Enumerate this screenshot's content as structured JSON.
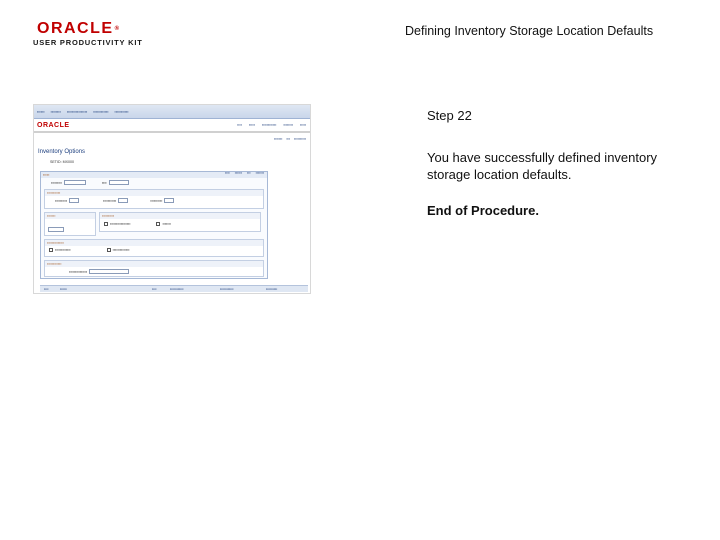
{
  "header": {
    "logo_oracle": "ORACLE",
    "logo_upk": "USER PRODUCTIVITY KIT",
    "document_title": "Defining Inventory Storage Location Defaults"
  },
  "screenshot": {
    "page_title": "Inventory Options",
    "unit": "SETID: MX000"
  },
  "step": {
    "label": "Step 22",
    "description": "You have successfully defined inventory storage location defaults.",
    "end_text": "End of Procedure."
  },
  "colors": {
    "oracle_red": "#c00000",
    "nav_blue": "#1b3c7a"
  }
}
